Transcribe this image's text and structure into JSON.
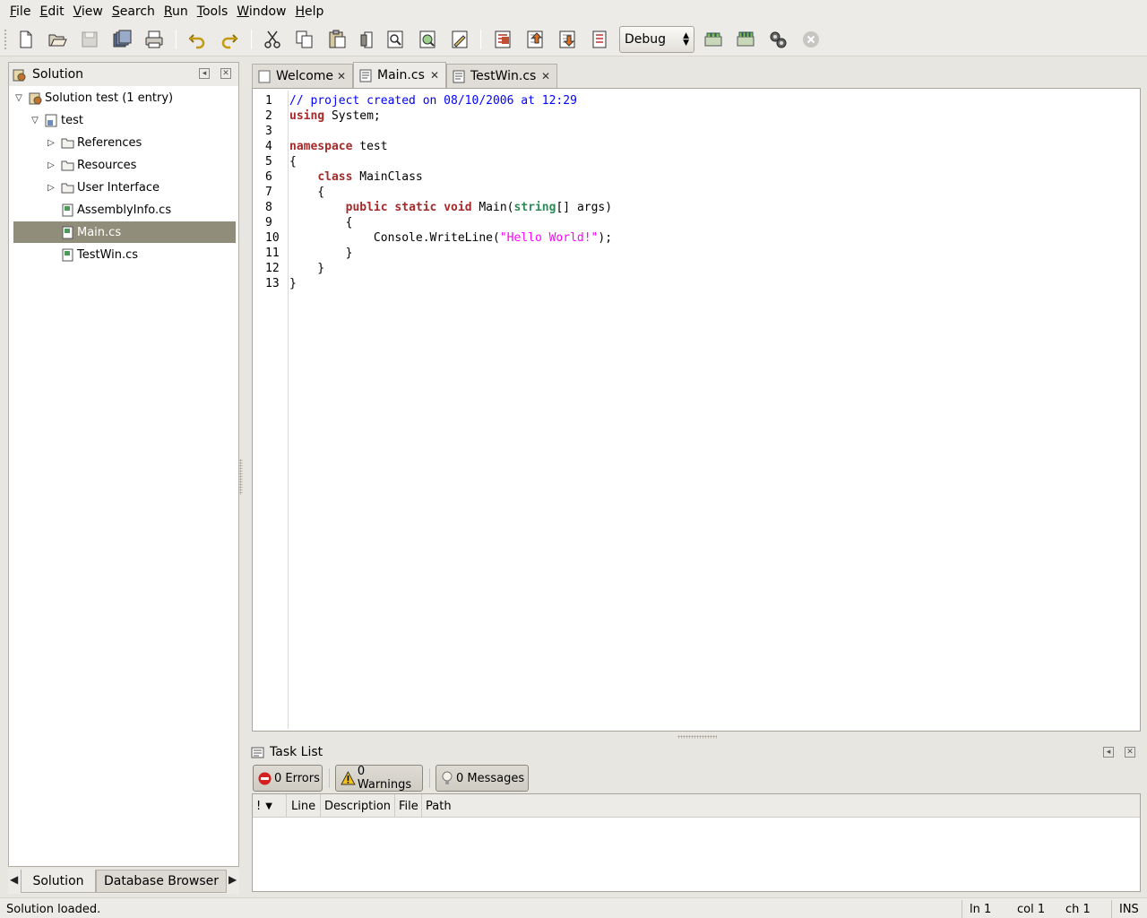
{
  "menu": [
    "File",
    "Edit",
    "View",
    "Search",
    "Run",
    "Tools",
    "Window",
    "Help"
  ],
  "toolbar": {
    "config_value": "Debug",
    "icons": [
      "new-file-icon",
      "open-icon",
      "save-icon",
      "save-all-icon",
      "print-icon",
      "undo-icon",
      "redo-icon",
      "cut-icon",
      "copy-icon",
      "paste-icon",
      "delete-icon",
      "find-icon",
      "find-in-files-icon",
      "replace-icon",
      "toggle-bookmark-icon",
      "prev-bookmark-icon",
      "next-bookmark-icon",
      "clear-bookmarks-icon",
      "build-icon",
      "rebuild-icon",
      "run-icon",
      "stop-icon"
    ]
  },
  "solution_pad": {
    "title": "Solution",
    "tree": [
      {
        "label": "Solution test (1 entry)",
        "type": "solution",
        "expanded": true
      },
      {
        "label": "test",
        "type": "project",
        "expanded": true
      },
      {
        "label": "References",
        "type": "folder",
        "expanded": false
      },
      {
        "label": "Resources",
        "type": "folder",
        "expanded": false
      },
      {
        "label": "User Interface",
        "type": "folder",
        "expanded": false
      },
      {
        "label": "AssemblyInfo.cs",
        "type": "cs-file"
      },
      {
        "label": "Main.cs",
        "type": "cs-file",
        "selected": true
      },
      {
        "label": "TestWin.cs",
        "type": "cs-file"
      }
    ],
    "tabs": [
      "Solution",
      "Database Browser"
    ]
  },
  "doc_tabs": [
    {
      "label": "Welcome",
      "active": false
    },
    {
      "label": "Main.cs",
      "active": true
    },
    {
      "label": "TestWin.cs",
      "active": false
    }
  ],
  "editor": {
    "line_numbers": [
      "1",
      "2",
      "3",
      "4",
      "5",
      "6",
      "7",
      "8",
      "9",
      "10",
      "11",
      "12",
      "13"
    ],
    "code": [
      [
        {
          "t": "// project created on 08/10/2006 at 12:29",
          "c": "cm"
        }
      ],
      [
        {
          "t": "using",
          "c": "kw"
        },
        {
          "t": " System;",
          "c": ""
        }
      ],
      [],
      [
        {
          "t": "namespace",
          "c": "kw"
        },
        {
          "t": " test",
          "c": ""
        }
      ],
      [
        {
          "t": "{",
          "c": ""
        }
      ],
      [
        {
          "t": "    ",
          "c": ""
        },
        {
          "t": "class",
          "c": "kw"
        },
        {
          "t": " MainClass",
          "c": ""
        }
      ],
      [
        {
          "t": "    {",
          "c": ""
        }
      ],
      [
        {
          "t": "        ",
          "c": ""
        },
        {
          "t": "public",
          "c": "kw"
        },
        {
          "t": " ",
          "c": ""
        },
        {
          "t": "static",
          "c": "kw"
        },
        {
          "t": " ",
          "c": ""
        },
        {
          "t": "void",
          "c": "kw"
        },
        {
          "t": " Main(",
          "c": ""
        },
        {
          "t": "string",
          "c": "ty"
        },
        {
          "t": "[] args)",
          "c": ""
        }
      ],
      [
        {
          "t": "        {",
          "c": ""
        }
      ],
      [
        {
          "t": "            Console.WriteLine(",
          "c": ""
        },
        {
          "t": "\"Hello World!\"",
          "c": "st"
        },
        {
          "t": ");",
          "c": ""
        }
      ],
      [
        {
          "t": "        }",
          "c": ""
        }
      ],
      [
        {
          "t": "    }",
          "c": ""
        }
      ],
      [
        {
          "t": "}",
          "c": ""
        }
      ]
    ]
  },
  "task_list": {
    "title": "Task List",
    "errors_btn": "0 Errors",
    "warnings_btn": "0 Warnings",
    "messages_btn": "0 Messages",
    "columns": [
      "!",
      "Line",
      "Description",
      "File",
      "Path"
    ]
  },
  "status": {
    "message": "Solution loaded.",
    "line": "ln 1",
    "col": "col 1",
    "ch": "ch 1",
    "mode": "INS"
  },
  "colors": {
    "keyword": "#a52a2a",
    "type": "#2e8b57",
    "comment": "#0000ff",
    "string": "#ff00ff",
    "selection": "#918d7b"
  }
}
